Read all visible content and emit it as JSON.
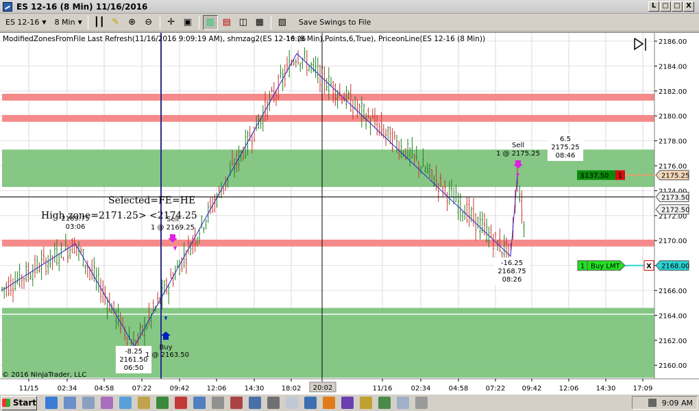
{
  "window": {
    "title": "ES 12-16 (8 Min)  11/16/2016",
    "buttons": [
      "L",
      "□",
      "□",
      "X"
    ]
  },
  "toolbar": {
    "instrument": "ES 12-16",
    "interval": "8 Min",
    "save_swings_label": "Save Swings to File"
  },
  "chart": {
    "indicator_text": "ModifiedZonesFromFile Last Refresh(11/16/2016 9:09:19 AM), shmzag2(ES 12-16 (8 Min),Points,6,True), PriceonLine(ES 12-16 (8 Min))",
    "copyright": "© 2016 NinjaTrader, LLC",
    "price_ticks": [
      "2186.00",
      "2184.00",
      "2182.00",
      "2180.00",
      "2178.00",
      "2176.00",
      "2174.00",
      "2172.00",
      "2170.00",
      "2168.00",
      "2166.00",
      "2164.00",
      "2162.00",
      "2160.00"
    ],
    "time_ticks": [
      "11/15",
      "02:34",
      "04:58",
      "07:22",
      "09:42",
      "12:06",
      "14:30",
      "18:02",
      "20:02",
      "11/16",
      "02:34",
      "04:58",
      "07:22",
      "09:42",
      "12:06",
      "14:30",
      "17:09"
    ],
    "zones": {
      "red": [
        2181.5,
        2179.8,
        2169.8
      ],
      "green": [
        [
          2174.3,
          2177.3
        ],
        [
          2159.0,
          2164.6
        ]
      ]
    },
    "crosshair_price": "2173.50",
    "crosshair_time": "20:02",
    "markers": {
      "last_price": "2175.25",
      "pnl": "$137.50",
      "position_qty": "1",
      "limit_qty": "1",
      "limit_type": "Buy LMT",
      "limit_price": "2168.00",
      "limit_cancel": "X",
      "price_2172": "2172.50"
    },
    "annotations": {
      "selected": "Selected=FE=HE",
      "high_zone": "High  zone=2171.25>  <2174.25",
      "swing_left_high": [
        "2169.75",
        "03:06"
      ],
      "swing_low1": [
        "-8.25",
        "2161.50",
        "06:50"
      ],
      "swing_top": [
        "18:26"
      ],
      "swing_low2": [
        "-16.25",
        "2168.75",
        "08:26"
      ],
      "swing_last": [
        "6.5",
        "2175.25",
        "08:46"
      ],
      "buy1": [
        "Buy",
        "1 @ 2163.50"
      ],
      "sell1": [
        "Sell",
        "1 @ 2169.25"
      ],
      "sell2": [
        "Sell",
        "1 @ 2175.25"
      ]
    }
  },
  "taskbar": {
    "start_label": "Start",
    "clock": "9:09 AM"
  },
  "colors": {
    "red_zone": "#f58a8a",
    "green_zone": "#7fc47f",
    "up_bar": "#1e7e1e",
    "down_bar": "#c8322d",
    "zigzag": "#2727d0",
    "pnl_bg": "#0a8a0a",
    "position_bg": "#d01010",
    "limit_bg": "#22e022"
  }
}
